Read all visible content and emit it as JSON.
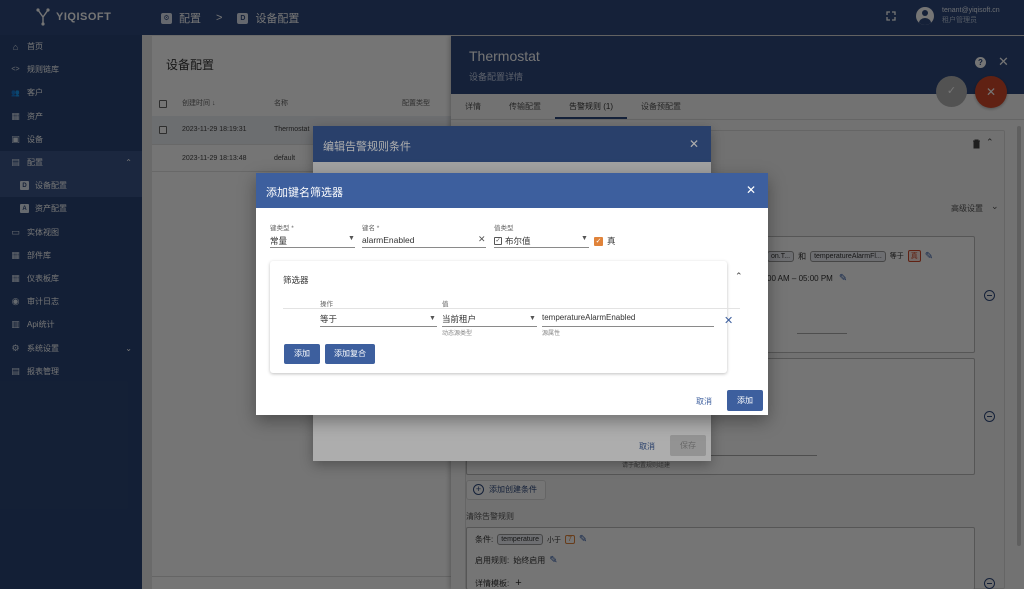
{
  "app": {
    "brand": "YIQISOFT"
  },
  "breadcrumb": {
    "parent": "配置",
    "parent_icon": "⚙",
    "current": "设备配置",
    "current_icon": "D"
  },
  "user": {
    "email": "tenant@yiqisoft.cn",
    "role": "租户管理员"
  },
  "sidebar": {
    "items": [
      {
        "label": "首页",
        "icon": "home-icon",
        "glyph": "⌂"
      },
      {
        "label": "规则链库",
        "icon": "code-icon",
        "glyph": "<>"
      },
      {
        "label": "客户",
        "icon": "people-icon",
        "glyph": "👥"
      },
      {
        "label": "资产",
        "icon": "domain-icon",
        "glyph": "▦"
      },
      {
        "label": "设备",
        "icon": "devices-icon",
        "glyph": "▣"
      },
      {
        "label": "配置",
        "icon": "settings-icon",
        "glyph": "▤",
        "chevron": "⌃",
        "active": true
      },
      {
        "label": "设备配置",
        "icon": "device-profile-icon",
        "glyph": "D",
        "sub": true,
        "active": true
      },
      {
        "label": "资产配置",
        "icon": "asset-profile-icon",
        "glyph": "A",
        "sub": true
      },
      {
        "label": "实体视图",
        "icon": "view-icon",
        "glyph": "▭"
      },
      {
        "label": "部件库",
        "icon": "widgets-icon",
        "glyph": "▦"
      },
      {
        "label": "仪表板库",
        "icon": "dashboard-icon",
        "glyph": "▦"
      },
      {
        "label": "审计日志",
        "icon": "audit-icon",
        "glyph": "◉"
      },
      {
        "label": "Api统计",
        "icon": "api-icon",
        "glyph": "▥"
      },
      {
        "label": "系统设置",
        "icon": "gear-icon",
        "glyph": "⚙",
        "chevron": "⌄"
      },
      {
        "label": "报表管理",
        "icon": "report-icon",
        "glyph": "▤"
      }
    ]
  },
  "profiles": {
    "title": "设备配置",
    "columns": {
      "created": "创建时间 ↓",
      "name": "名称",
      "type": "配置类型"
    },
    "rows": [
      {
        "created": "2023-11-29 18:19:31",
        "name": "Thermostat"
      },
      {
        "created": "2023-11-29 18:13:48",
        "name": "default"
      }
    ]
  },
  "drawer": {
    "title": "Thermostat",
    "subtitle": "设备配置详情",
    "tabs": [
      "详情",
      "传输配置",
      "告警规则 (1)",
      "设备预配置"
    ],
    "advanced": "高级设置",
    "cond_fragment_1": "on.T...",
    "and_word": "和",
    "cond_chip_2": "temperatureAlarmFl...",
    "equals": "等于",
    "true_badge": "真",
    "schedule_fragment": "00 AM – 05:00 PM",
    "hint_text": "请于配置规则组建",
    "add_create_condition": "添加创建条件",
    "clear_rule_title": "清除告警规则",
    "cond_label": "条件:",
    "clear_chip": "temperature",
    "less_than": "小于",
    "clear_value": "7",
    "enable_label": "启用规则:",
    "enable_value": "始终启用",
    "detail_template": "详情模板:"
  },
  "dialog_edit": {
    "title": "编辑告警规则条件",
    "cancel": "取消",
    "save": "保存"
  },
  "dialog_add": {
    "title": "添加键名筛选器",
    "key_type_label": "键类型 *",
    "key_type_value": "常量",
    "key_name_label": "键名 *",
    "key_name_value": "alarmEnabled",
    "value_type_label": "值类型",
    "value_type_value": "布尔值",
    "bool_label": "真",
    "filters_title": "筛选器",
    "op_header": "操作",
    "value_header": "值",
    "op_value": "等于",
    "source_value": "当前租户",
    "source_hint": "动态源类型",
    "attr_value": "temperatureAlarmEnabled",
    "attr_hint": "源属性",
    "add_btn": "添加",
    "add_complex_btn": "添加复合",
    "cancel": "取消",
    "confirm": "添加"
  }
}
